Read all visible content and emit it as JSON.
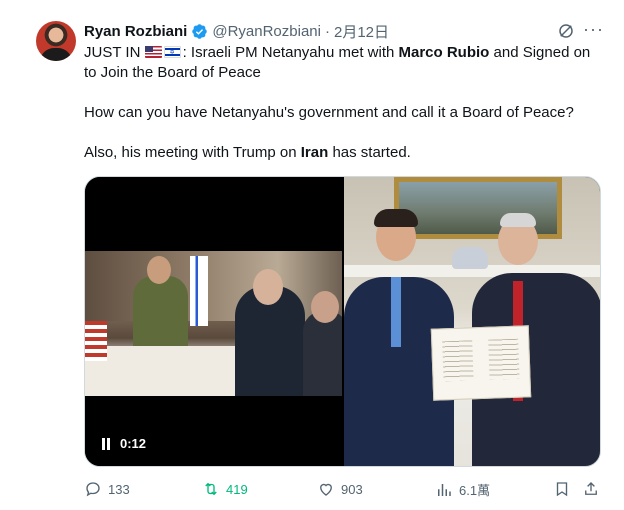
{
  "author": {
    "name": "Ryan Rozbiani",
    "handle": "@RyanRozbiani",
    "separator": "·",
    "date": "2月12日"
  },
  "text": {
    "p1_a": "JUST IN ",
    "p1_b": ": Israeli PM Netanyahu met with ",
    "p1_bold1": "Marco Rubio",
    "p1_c": " and Signed on to Join the Board of Peace",
    "p2": "How can you have Netanyahu's government and call it a Board of Peace?",
    "p3_a": "Also, his meeting with Trump on ",
    "p3_bold": "Iran",
    "p3_b": " has started."
  },
  "media": {
    "video_time": "0:12"
  },
  "actions": {
    "replies": "133",
    "retweets": "419",
    "likes": "903",
    "views": "6.1萬"
  },
  "colors": {
    "text": "#0f1419",
    "secondary": "#536471",
    "verified": "#1d9bf0",
    "retweet_active": "#00ba7c"
  },
  "icons": [
    "verified-badge-icon",
    "grok-icon",
    "more-icon",
    "us-flag-icon",
    "israel-flag-icon",
    "pause-icon",
    "reply-icon",
    "retweet-icon",
    "like-icon",
    "views-icon",
    "bookmark-icon",
    "share-icon"
  ]
}
